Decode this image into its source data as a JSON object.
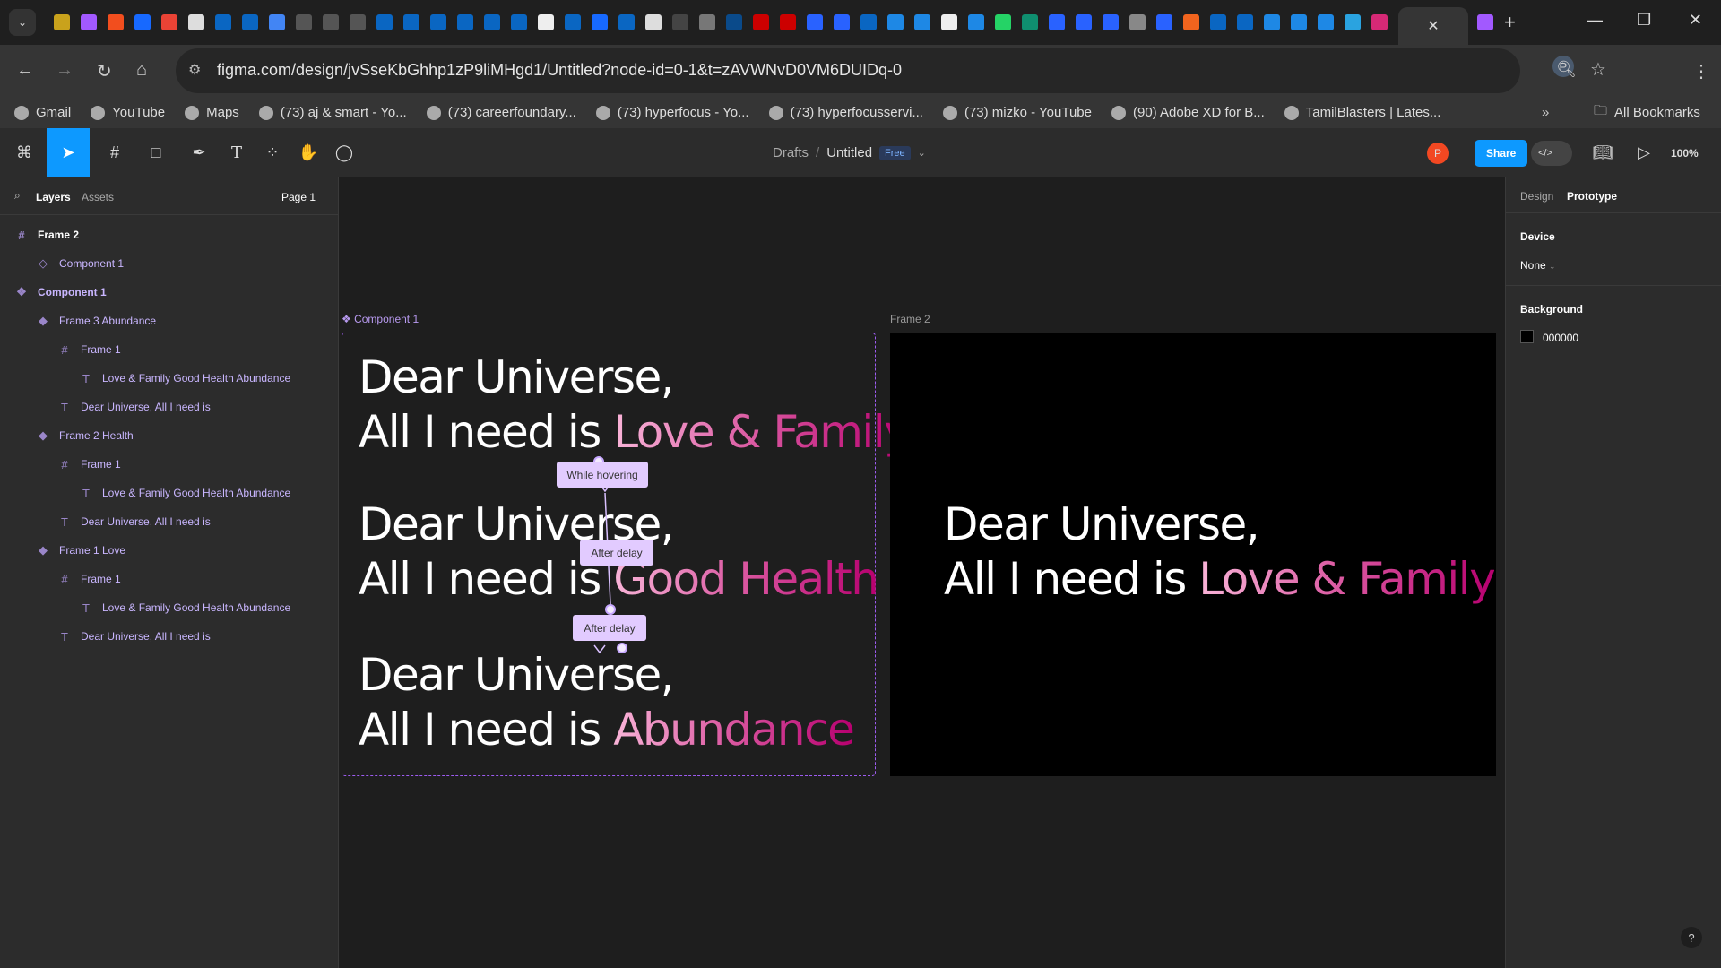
{
  "browser": {
    "favicons": [
      {
        "name": "extension",
        "color": "#c9a21c"
      },
      {
        "name": "figma",
        "color": "#a259ff"
      },
      {
        "name": "figma",
        "color": "#f24e1e"
      },
      {
        "name": "behance",
        "color": "#1769ff"
      },
      {
        "name": "gmail",
        "color": "#ea4335"
      },
      {
        "name": "site",
        "color": "#ddd"
      },
      {
        "name": "linkedin",
        "color": "#0a66c2"
      },
      {
        "name": "linkedin",
        "color": "#0a66c2"
      },
      {
        "name": "calendar",
        "color": "#4285f4"
      },
      {
        "name": "site",
        "color": "#555"
      },
      {
        "name": "site",
        "color": "#555"
      },
      {
        "name": "site",
        "color": "#555"
      },
      {
        "name": "linkedin",
        "color": "#0a66c2"
      },
      {
        "name": "linkedin",
        "color": "#0a66c2"
      },
      {
        "name": "linkedin",
        "color": "#0a66c2"
      },
      {
        "name": "linkedin",
        "color": "#0a66c2"
      },
      {
        "name": "linkedin",
        "color": "#0a66c2"
      },
      {
        "name": "linkedin",
        "color": "#0a66c2"
      },
      {
        "name": "openai",
        "color": "#eee"
      },
      {
        "name": "linkedin",
        "color": "#0a66c2"
      },
      {
        "name": "site",
        "color": "#1769ff"
      },
      {
        "name": "linkedin",
        "color": "#0a66c2"
      },
      {
        "name": "site",
        "color": "#ddd"
      },
      {
        "name": "site",
        "color": "#444"
      },
      {
        "name": "site",
        "color": "#777"
      },
      {
        "name": "edge",
        "color": "#0a4a8a"
      },
      {
        "name": "tm",
        "color": "#c00"
      },
      {
        "name": "tm",
        "color": "#c00"
      },
      {
        "name": "site",
        "color": "#2962ff"
      },
      {
        "name": "site",
        "color": "#2962ff"
      },
      {
        "name": "linkedin",
        "color": "#0a66c2"
      },
      {
        "name": "video",
        "color": "#1e88e5"
      },
      {
        "name": "video",
        "color": "#1e88e5"
      },
      {
        "name": "openai",
        "color": "#eee"
      },
      {
        "name": "video",
        "color": "#1e88e5"
      },
      {
        "name": "whatsapp",
        "color": "#25d366"
      },
      {
        "name": "site",
        "color": "#0f8f6f"
      },
      {
        "name": "site",
        "color": "#2962ff"
      },
      {
        "name": "site",
        "color": "#2962ff"
      },
      {
        "name": "site",
        "color": "#2962ff"
      },
      {
        "name": "globe",
        "color": "#888"
      },
      {
        "name": "site",
        "color": "#2962ff"
      },
      {
        "name": "etsy",
        "color": "#f1641e"
      },
      {
        "name": "linkedin",
        "color": "#0a66c2"
      },
      {
        "name": "linkedin",
        "color": "#0a66c2"
      },
      {
        "name": "video",
        "color": "#1e88e5"
      },
      {
        "name": "video",
        "color": "#1e88e5"
      },
      {
        "name": "video",
        "color": "#1e88e5"
      },
      {
        "name": "telegram",
        "color": "#2aa3e0"
      },
      {
        "name": "instagram",
        "color": "#d62976"
      }
    ],
    "active_tab_close": "✕",
    "new_tab": "+",
    "url": "figma.com/design/jvSseKbGhhp1zP9liMHgd1/Untitled?node-id=0-1&t=zAVWNvD0VM6DUIDq-0",
    "profile_initial": "P",
    "bookmarks": [
      "Gmail",
      "YouTube",
      "Maps",
      "(73) aj & smart - Yo...",
      "(73) careerfoundary...",
      "(73) hyperfocus - Yo...",
      "(73) hyperfocusservi...",
      "(73) mizko - YouTube",
      "(90) Adobe XD for B...",
      "TamilBlasters | Lates..."
    ],
    "all_bookmarks": "All Bookmarks"
  },
  "toolbar": {
    "breadcrumb_parent": "Drafts",
    "file_name": "Untitled",
    "plan_badge": "Free",
    "avatar": "P",
    "share": "Share",
    "zoom": "100%"
  },
  "layers_panel": {
    "tabs": [
      "Layers",
      "Assets"
    ],
    "page": "Page 1",
    "items": [
      {
        "label": "Frame 2",
        "icon": "frame-icon",
        "depth": 0
      },
      {
        "label": "Component 1",
        "icon": "instance-icon",
        "depth": 1
      },
      {
        "label": "Component 1",
        "icon": "component-set-icon",
        "depth": 0
      },
      {
        "label": "Frame 3 Abundance",
        "icon": "variant-icon",
        "depth": 1
      },
      {
        "label": "Frame 1",
        "icon": "frame-icon",
        "depth": 2
      },
      {
        "label": "Love & Family Good Health Abundance",
        "icon": "text-icon",
        "depth": 3
      },
      {
        "label": "Dear Universe, All I need is",
        "icon": "text-icon",
        "depth": 2
      },
      {
        "label": "Frame 2 Health",
        "icon": "variant-icon",
        "depth": 1
      },
      {
        "label": "Frame 1",
        "icon": "frame-icon",
        "depth": 2
      },
      {
        "label": "Love & Family Good Health Abundance",
        "icon": "text-icon",
        "depth": 3
      },
      {
        "label": "Dear Universe, All I need is",
        "icon": "text-icon",
        "depth": 2
      },
      {
        "label": "Frame 1 Love",
        "icon": "variant-icon",
        "depth": 1
      },
      {
        "label": "Frame 1",
        "icon": "frame-icon",
        "depth": 2
      },
      {
        "label": "Love & Family Good Health Abundance",
        "icon": "text-icon",
        "depth": 3
      },
      {
        "label": "Dear Universe, All I need is",
        "icon": "text-icon",
        "depth": 2
      }
    ]
  },
  "canvas": {
    "component_label": "Component 1",
    "frame2_label": "Frame 2",
    "line1": "Dear Universe,",
    "line2_prefix": "All I need is ",
    "variants": [
      "Love & Family",
      "Good Health",
      "Abundance"
    ],
    "interactions": [
      "While hovering",
      "After delay",
      "After delay"
    ],
    "frame2_highlight": "Love & Family"
  },
  "right_panel": {
    "tabs": [
      "Design",
      "Prototype"
    ],
    "device_label": "Device",
    "device_value": "None",
    "background_label": "Background",
    "background_hex": "000000"
  },
  "help": "?"
}
